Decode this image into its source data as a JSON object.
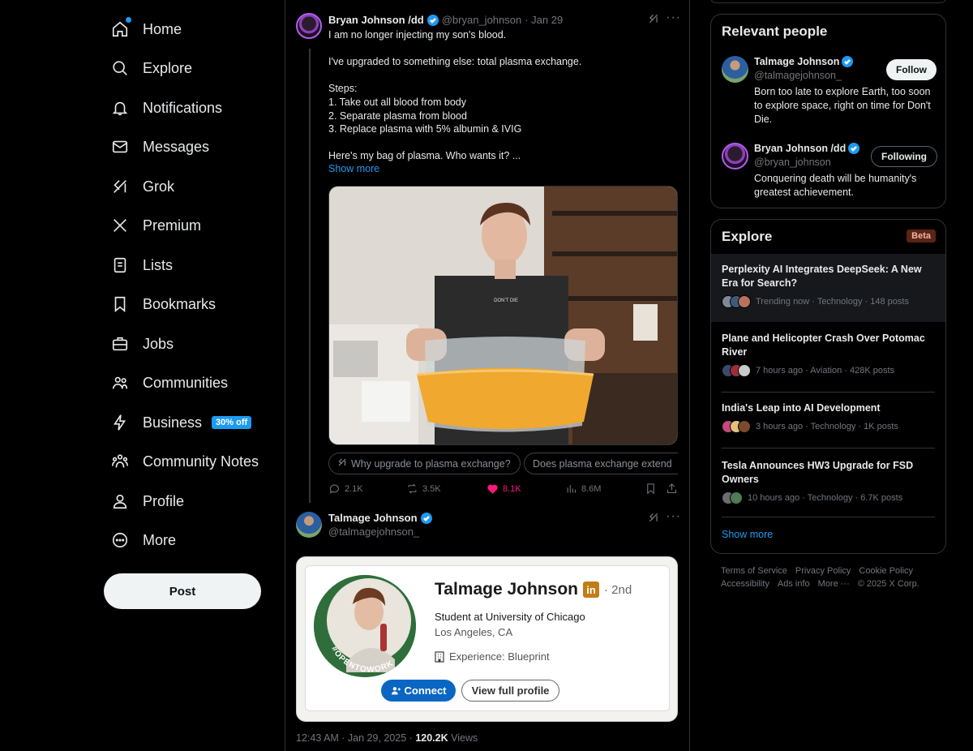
{
  "nav": {
    "items": [
      {
        "label": "Home"
      },
      {
        "label": "Explore"
      },
      {
        "label": "Notifications"
      },
      {
        "label": "Messages"
      },
      {
        "label": "Grok"
      },
      {
        "label": "Premium"
      },
      {
        "label": "Lists"
      },
      {
        "label": "Bookmarks"
      },
      {
        "label": "Jobs"
      },
      {
        "label": "Communities"
      },
      {
        "label": "Business",
        "badge": "30% off"
      },
      {
        "label": "Community Notes"
      },
      {
        "label": "Profile"
      },
      {
        "label": "More"
      }
    ],
    "post_label": "Post"
  },
  "tweet": {
    "author_name": "Bryan Johnson /dd",
    "author_handle": "@bryan_johnson",
    "time": "· Jan 29",
    "text": "I am no longer injecting my son's blood.\n\nI've upgraded to something else: total plasma exchange.\n\nSteps:\n1. Take out all blood from body\n2. Separate plasma from blood\n3. Replace plasma with 5% albumin & IVIG\n\nHere's my bag of plasma. Who wants it? ...",
    "show_more": "Show more",
    "photo_shirt_text": "DON'T DIE",
    "grok_chips": [
      "Why upgrade to plasma exchange?",
      "Does plasma exchange extend"
    ],
    "actions": {
      "replies": "2.1K",
      "reposts": "3.5K",
      "likes": "8.1K",
      "views": "8.6M"
    }
  },
  "reply": {
    "author_name": "Talmage Johnson",
    "author_handle": "@talmagejohnson_",
    "linkedin": {
      "name": "Talmage Johnson",
      "badge": "in",
      "degree": "· 2nd",
      "headline": "Student at University of Chicago",
      "location": "Los Angeles, CA",
      "experience": "Experience: Blueprint",
      "ring_text": "#OPENTOWORK",
      "connect_label": "Connect",
      "view_label": "View full profile"
    },
    "meta_time": "12:43 AM · Jan 29, 2025 ·",
    "meta_views": "120.2K",
    "meta_views_label": "Views"
  },
  "relevant_people": {
    "title": "Relevant people",
    "people": [
      {
        "name": "Talmage Johnson",
        "handle": "@talmagejohnson_",
        "bio": "Born too late to explore Earth, too soon to explore space, right on time for Don't Die.",
        "button": "Follow"
      },
      {
        "name": "Bryan Johnson /dd",
        "handle": "@bryan_johnson",
        "bio": "Conquering death will be humanity's greatest achievement.",
        "button": "Following"
      }
    ]
  },
  "explore": {
    "title": "Explore",
    "badge": "Beta",
    "trends": [
      {
        "title": "Perplexity AI Integrates DeepSeek: A New Era for Search?",
        "meta": "Trending now · Technology · 148 posts"
      },
      {
        "title": "Plane and Helicopter Crash Over Potomac River",
        "meta": "7 hours ago · Aviation · 428K posts"
      },
      {
        "title": "India's Leap into AI Development",
        "meta": "3 hours ago · Technology · 1K posts"
      },
      {
        "title": "Tesla Announces HW3 Upgrade for FSD Owners",
        "meta": "10 hours ago · Technology · 6.7K posts"
      }
    ],
    "show_more": "Show more"
  },
  "footer": {
    "row1": [
      "Terms of Service",
      "Privacy Policy",
      "Cookie Policy"
    ],
    "row2": [
      "Accessibility",
      "Ads info",
      "More ···",
      "© 2025 X Corp."
    ]
  },
  "colors": {
    "accent": "#1d9bf0",
    "like": "#f91880",
    "linkedin_blue": "#0a66c2",
    "opentowork_green": "#2f6e3a"
  }
}
